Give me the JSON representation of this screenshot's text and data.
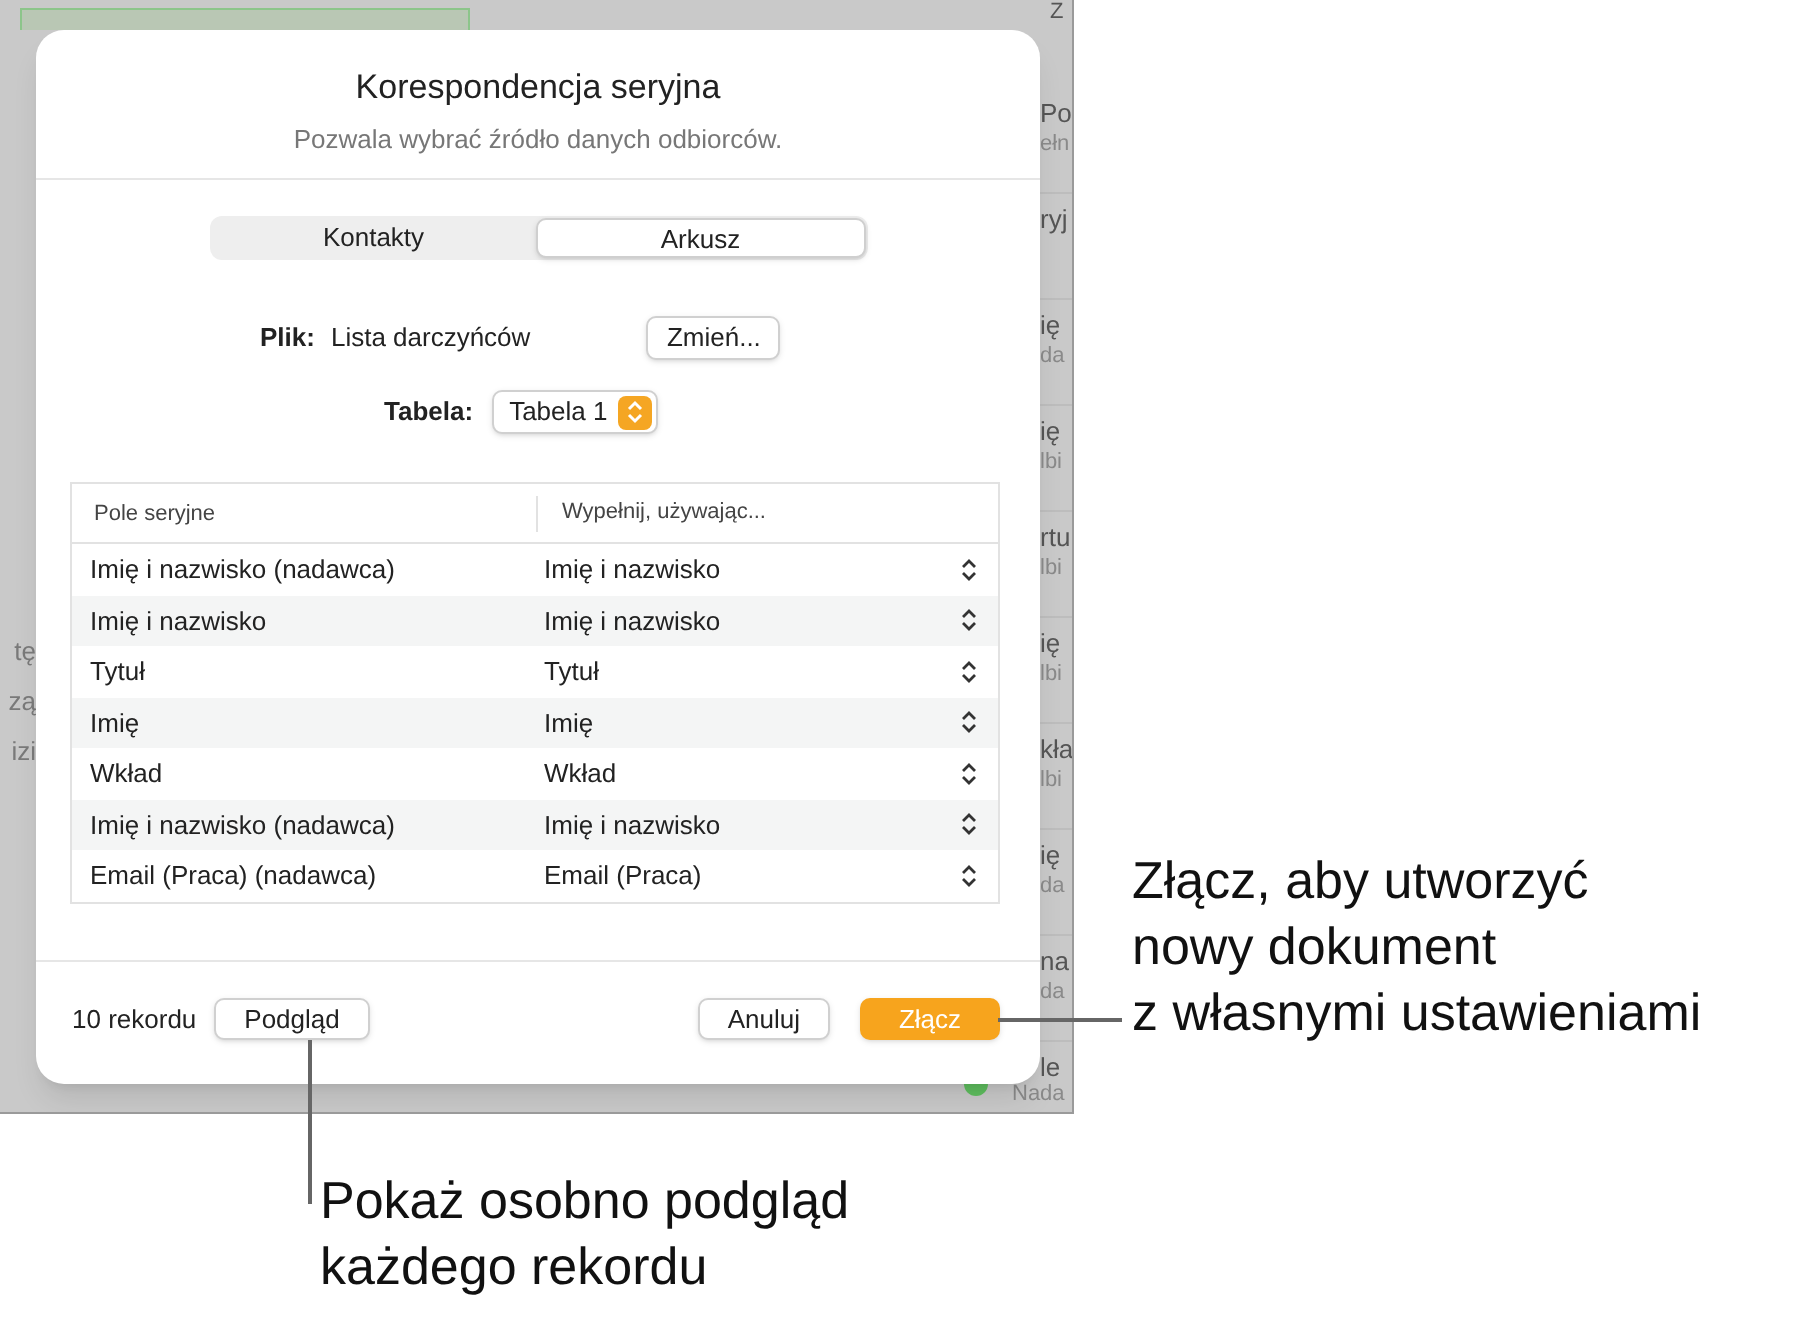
{
  "background": {
    "corner_fragment": "Z",
    "left_fragments": [
      "tę",
      "zą",
      "izi"
    ],
    "right_items": [
      {
        "title": "Po",
        "subtitle": "ełn"
      },
      {
        "title": "ryj"
      },
      {
        "title": "ię",
        "subtitle": "da"
      },
      {
        "title": "ię",
        "subtitle": "lbi"
      },
      {
        "title": "rtu",
        "subtitle": "lbi"
      },
      {
        "title": "ię",
        "subtitle": "lbi"
      },
      {
        "title": "kła",
        "subtitle": "lbi"
      },
      {
        "title": "ię",
        "subtitle": "da"
      },
      {
        "title": "na",
        "subtitle": "da"
      },
      {
        "title": "le",
        "subtitle": "Nada"
      }
    ]
  },
  "dialog": {
    "title": "Korespondencja seryjna",
    "subtitle": "Pozwala wybrać źródło danych odbiorców.",
    "segments": [
      {
        "label": "Kontakty",
        "selected": false
      },
      {
        "label": "Arkusz",
        "selected": true
      }
    ],
    "file": {
      "label": "Plik:",
      "value": "Lista darczyńców",
      "button": "Zmień..."
    },
    "table_picker": {
      "label": "Tabela:",
      "value": "Tabela 1"
    },
    "fields_table": {
      "columns": [
        "Pole seryjne",
        "Wypełnij, używając..."
      ],
      "rows": [
        [
          "Imię i nazwisko (nadawca)",
          "Imię i nazwisko"
        ],
        [
          "Imię i nazwisko",
          "Imię i nazwisko"
        ],
        [
          "Tytuł",
          "Tytuł"
        ],
        [
          "Imię",
          "Imię"
        ],
        [
          "Wkład",
          "Wkład"
        ],
        [
          "Imię i nazwisko (nadawca)",
          "Imię i nazwisko"
        ],
        [
          "Email (Praca) (nadawca)",
          "Email (Praca)"
        ]
      ]
    },
    "record_count": "10 rekordu",
    "buttons": [
      {
        "label": "Podgląd",
        "kind": "secondary"
      },
      {
        "label": "Anuluj",
        "kind": "secondary"
      },
      {
        "label": "Złącz",
        "kind": "primary"
      }
    ]
  },
  "callouts": [
    {
      "text": "Złącz, aby utworzyć\nnowy dokument\nz własnymi ustawieniami"
    },
    {
      "text": "Pokaż osobno podgląd\nkażdego rekordu"
    }
  ]
}
